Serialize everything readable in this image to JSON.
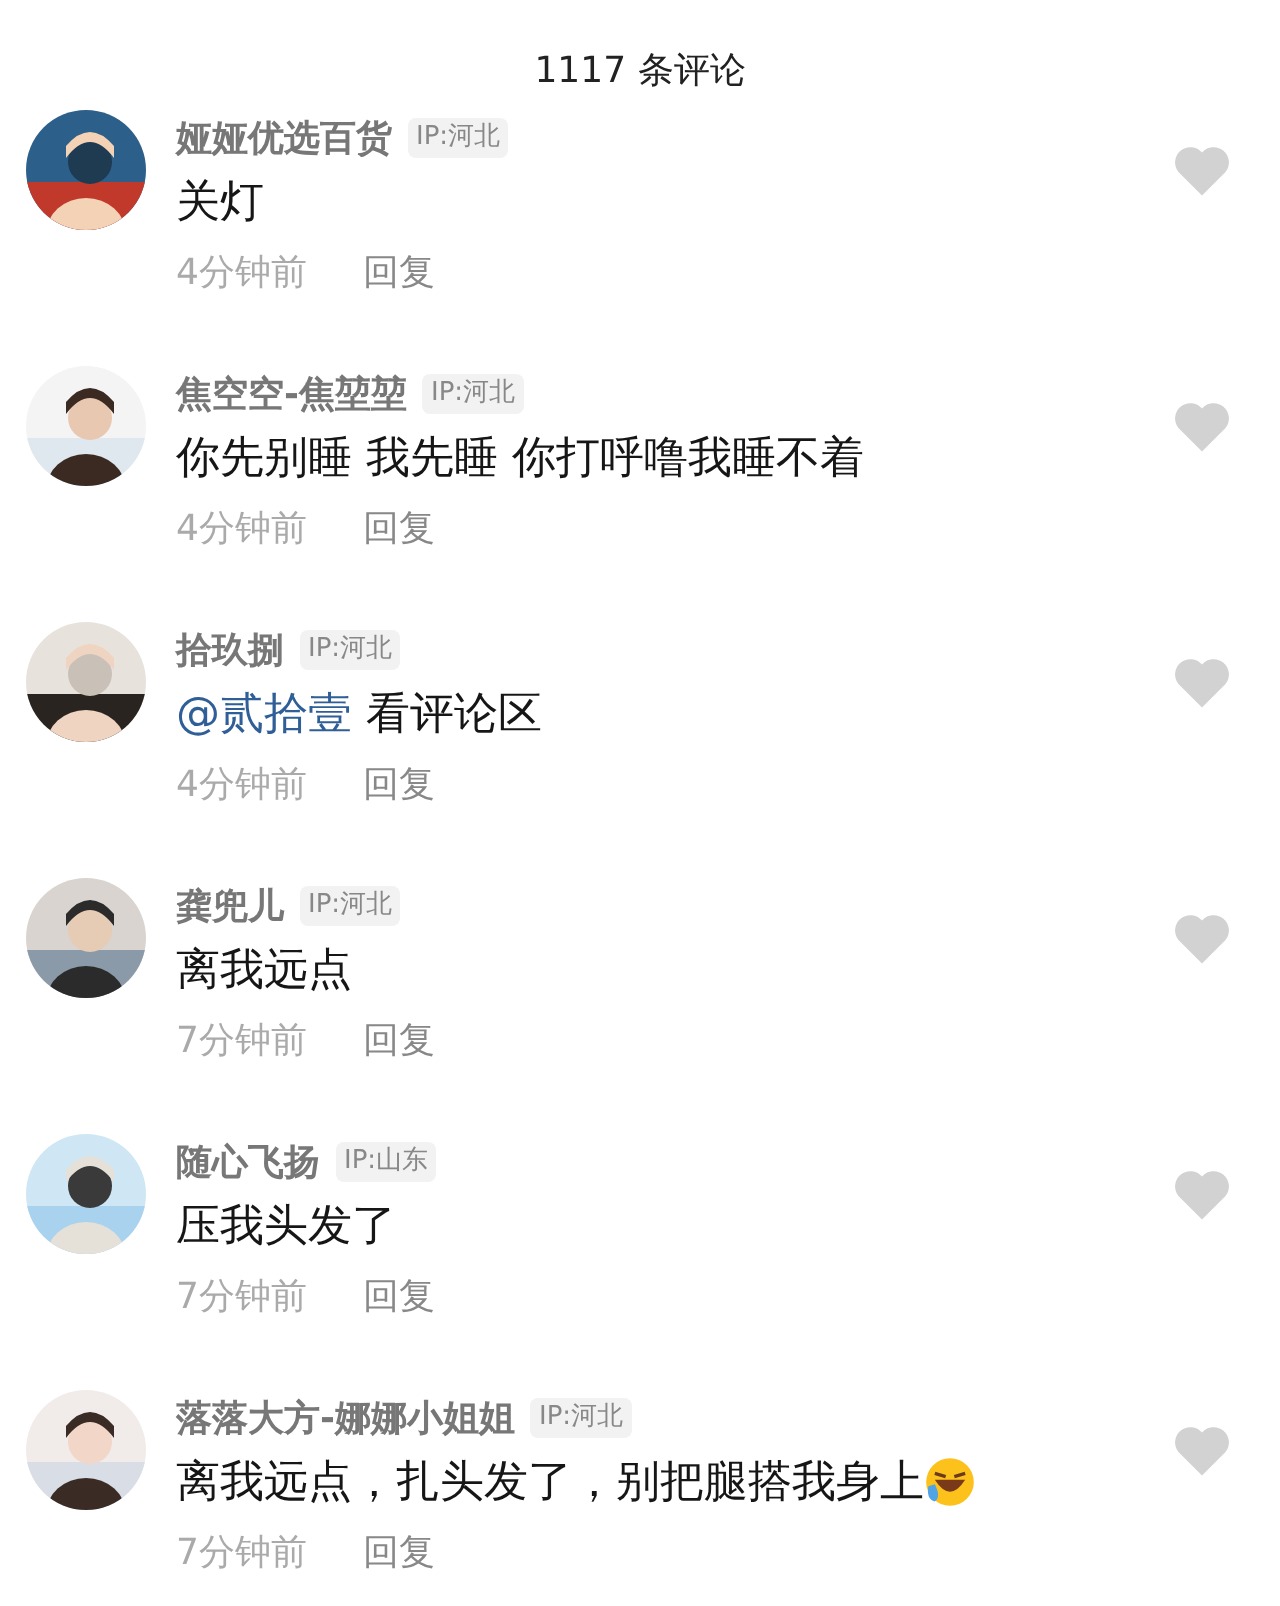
{
  "header": {
    "count_title": "1117 条评论"
  },
  "comments": [
    {
      "name": "娅娅优选百货",
      "ip": "IP:河北",
      "parts": [
        {
          "kind": "text",
          "text": "关灯"
        }
      ],
      "time": "4分钟前",
      "reply": "回复",
      "liked": false
    },
    {
      "name": "焦空空-焦堃堃",
      "ip": "IP:河北",
      "parts": [
        {
          "kind": "text",
          "text": "你先别睡 我先睡 你打呼噜我睡不着"
        }
      ],
      "time": "4分钟前",
      "reply": "回复",
      "liked": false
    },
    {
      "name": "拾玖捌",
      "ip": "IP:河北",
      "parts": [
        {
          "kind": "mention",
          "text": "@贰拾壹"
        },
        {
          "kind": "text",
          "text": " 看评论区"
        }
      ],
      "time": "4分钟前",
      "reply": "回复",
      "liked": false
    },
    {
      "name": "龚兜儿",
      "ip": "IP:河北",
      "parts": [
        {
          "kind": "text",
          "text": "离我远点"
        }
      ],
      "time": "7分钟前",
      "reply": "回复",
      "liked": false
    },
    {
      "name": "随心飞扬",
      "ip": "IP:山东",
      "parts": [
        {
          "kind": "text",
          "text": "压我头发了"
        }
      ],
      "time": "7分钟前",
      "reply": "回复",
      "liked": false
    },
    {
      "name": "落落大方-娜娜小姐姐",
      "ip": "IP:河北",
      "parts": [
        {
          "kind": "text",
          "text": "离我远点，扎头发了，别把腿搭我身上"
        },
        {
          "kind": "emoji"
        }
      ],
      "time": "7分钟前",
      "reply": "回复",
      "liked": false
    }
  ]
}
